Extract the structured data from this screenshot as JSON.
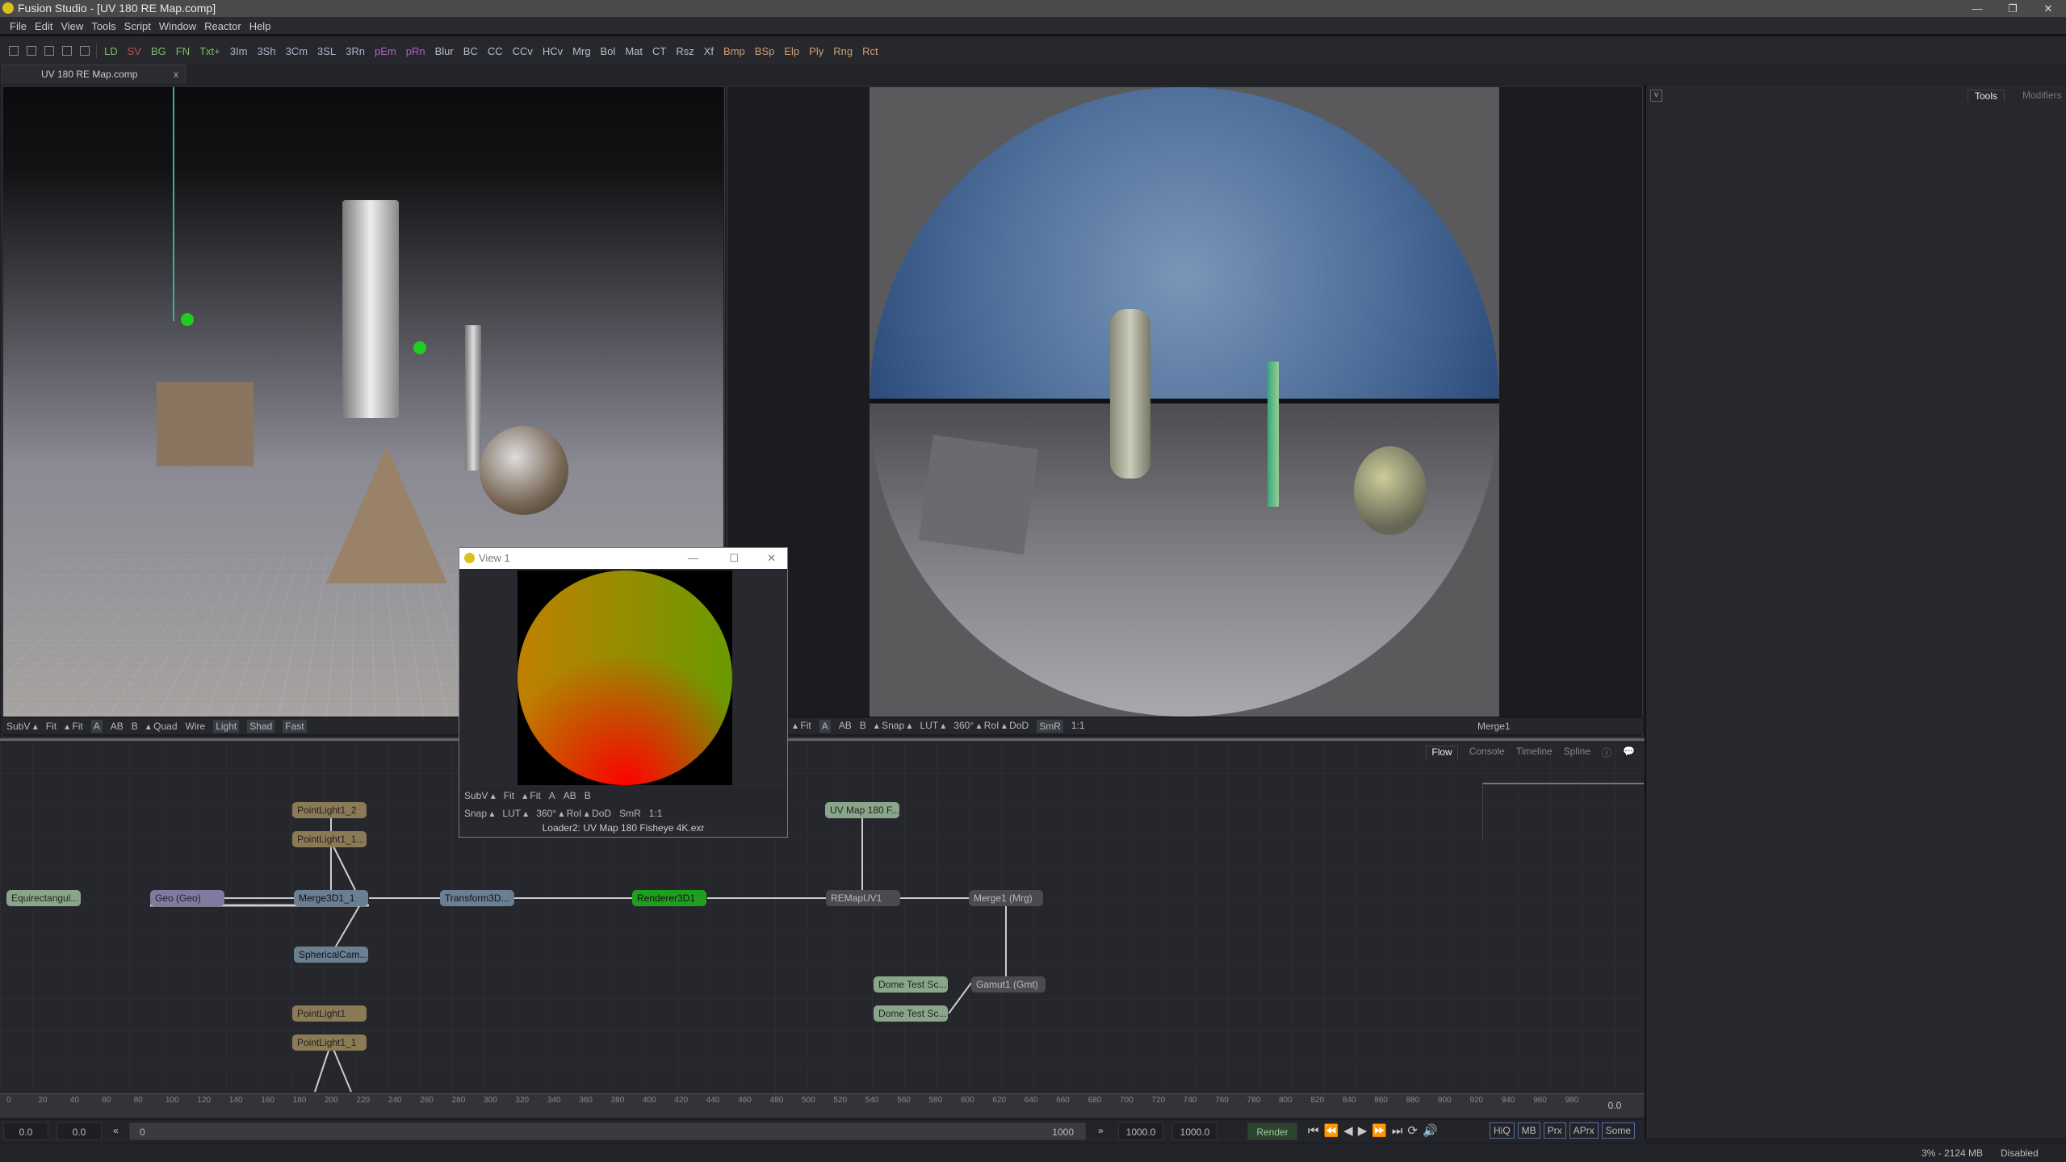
{
  "window": {
    "title": "Fusion Studio - [UV 180 RE Map.comp]"
  },
  "menu": [
    "File",
    "Edit",
    "View",
    "Tools",
    "Script",
    "Window",
    "Reactor",
    "Help"
  ],
  "toolbar": [
    {
      "label": "LD",
      "color": "#7fb86a"
    },
    {
      "label": "SV",
      "color": "#c05050"
    },
    {
      "label": "BG",
      "color": "#7fb86a"
    },
    {
      "label": "FN",
      "color": "#7fb86a"
    },
    {
      "label": "Txt+",
      "color": "#7fb86a"
    },
    {
      "label": "3Im",
      "color": "#a8b4cc"
    },
    {
      "label": "3Sh",
      "color": "#a8b4cc"
    },
    {
      "label": "3Cm",
      "color": "#a8b4cc"
    },
    {
      "label": "3SL",
      "color": "#a8b4cc"
    },
    {
      "label": "3Rn",
      "color": "#a8b4cc"
    },
    {
      "label": "pEm",
      "color": "#b060c0"
    },
    {
      "label": "pRn",
      "color": "#b060c0"
    },
    {
      "label": "Blur",
      "color": "#b9bdc8"
    },
    {
      "label": "BC",
      "color": "#b9bdc8"
    },
    {
      "label": "CC",
      "color": "#b9bdc8"
    },
    {
      "label": "CCv",
      "color": "#b9bdc8"
    },
    {
      "label": "HCv",
      "color": "#b9bdc8"
    },
    {
      "label": "Mrg",
      "color": "#b9bdc8"
    },
    {
      "label": "Bol",
      "color": "#b9bdc8"
    },
    {
      "label": "Mat",
      "color": "#b9bdc8"
    },
    {
      "label": "CT",
      "color": "#b9bdc8"
    },
    {
      "label": "Rsz",
      "color": "#b9bdc8"
    },
    {
      "label": "Xf",
      "color": "#b9bdc8"
    },
    {
      "label": "Bmp",
      "color": "#d0a070"
    },
    {
      "label": "BSp",
      "color": "#d0a070"
    },
    {
      "label": "Elp",
      "color": "#d0a070"
    },
    {
      "label": "Ply",
      "color": "#d0a070"
    },
    {
      "label": "Rng",
      "color": "#d0a070"
    },
    {
      "label": "Rct",
      "color": "#d0a070"
    }
  ],
  "tab": {
    "label": "UV 180 RE Map.comp",
    "close": "x"
  },
  "left_viewer": {
    "bar": [
      "SubV ▴",
      "Fit",
      "▴ Fit",
      "A",
      "AB",
      "B",
      "▴ Quad",
      "Wire",
      "Light",
      "Shad",
      "Fast"
    ]
  },
  "right_viewer": {
    "bar": [
      "it",
      "▴ Fit",
      "A",
      "AB",
      "B",
      "▴ Snap ▴",
      "LUT ▴",
      "360° ▴ RoI ▴ DoD",
      "SmR",
      "1:1"
    ],
    "node_name": "Merge1"
  },
  "right_panel": {
    "tabs": [
      "Tools",
      "Modifiers"
    ]
  },
  "flow_tabs": [
    "Flow",
    "Console",
    "Timeline",
    "Spline"
  ],
  "nodes": {
    "pointlight1_2": "PointLight1_2",
    "pointlight1_1a": "PointLight1_1...",
    "equirect": "Equirectangul...",
    "geo": "Geo  (Geo)",
    "merge3d": "Merge3D1_1",
    "transform3d": "Transform3D...",
    "renderer": "Renderer3D1",
    "remap": "REMapUV1",
    "merge1": "Merge1  (Mrg)",
    "spherical": "SphericalCam...",
    "uvmap": "UV Map 180 F...",
    "dome1": "Dome Test Sc...",
    "gamut": "Gamut1  (Gmt)",
    "dome2": "Dome Test Sc...",
    "pointlight1": "PointLight1",
    "pointlight1_1b": "PointLight1_1"
  },
  "view1": {
    "title": "View 1",
    "row1": [
      "SubV ▴",
      "Fit",
      "▴ Fit",
      "A",
      "AB",
      "B"
    ],
    "row2": [
      "Snap ▴",
      "LUT ▴",
      "360° ▴ RoI ▴ DoD",
      "SmR",
      "1:1"
    ],
    "caption": "Loader2: UV Map 180 Fisheye 4K.exr"
  },
  "timeline": {
    "ticks": [
      "0",
      "20",
      "40",
      "60",
      "80",
      "100",
      "120",
      "140",
      "160",
      "180",
      "200",
      "220",
      "240",
      "260",
      "280",
      "300",
      "320",
      "340",
      "360",
      "380",
      "400",
      "420",
      "440",
      "460",
      "480",
      "500",
      "520",
      "540",
      "560",
      "580",
      "600",
      "620",
      "640",
      "660",
      "680",
      "700",
      "720",
      "740",
      "760",
      "780",
      "800",
      "820",
      "840",
      "860",
      "880",
      "900",
      "920",
      "940",
      "960",
      "980"
    ],
    "current": "0.0"
  },
  "controls": {
    "start": "0.0",
    "current": "0.0",
    "range_start": "0",
    "range_end": "1000",
    "end": "1000.0",
    "global_end": "1000.0",
    "render": "Render",
    "toggles": [
      "HiQ",
      "MB",
      "Prx",
      "APrx",
      "Some"
    ]
  },
  "status": {
    "memory": "3% - 2124 MB",
    "state": "Disabled"
  }
}
